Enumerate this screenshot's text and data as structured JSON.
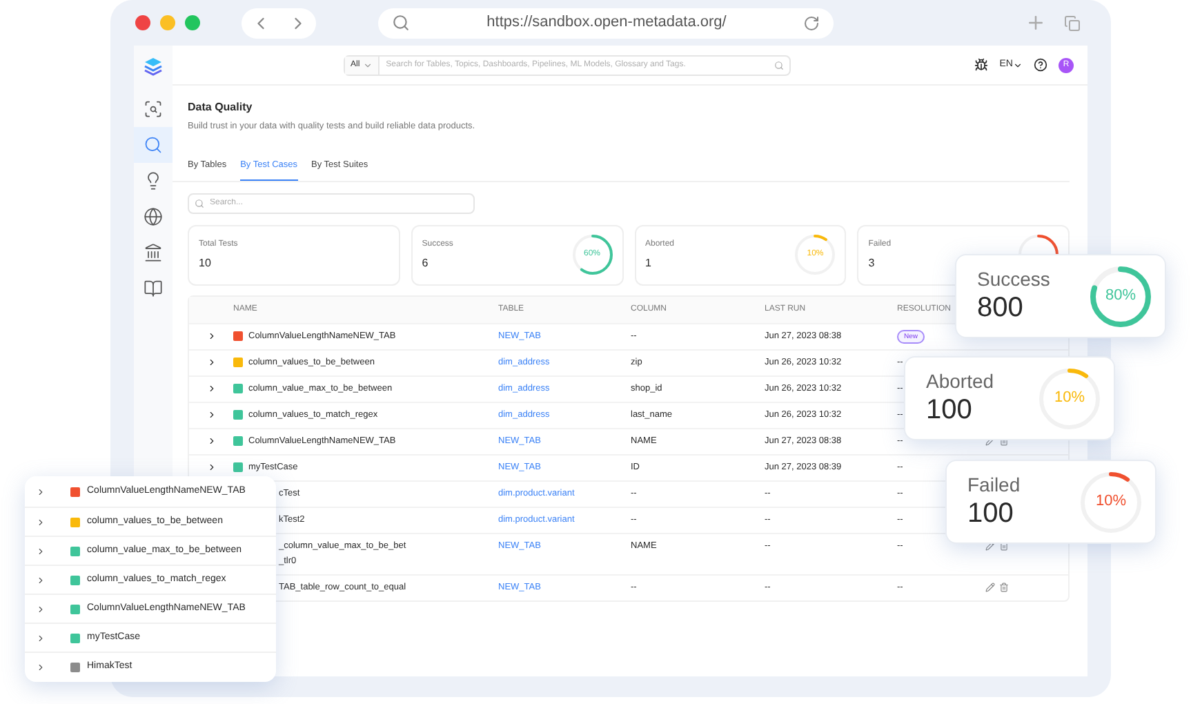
{
  "browser": {
    "url": "https://sandbox.open-metadata.org/"
  },
  "header": {
    "search_scope": "All",
    "search_placeholder": "Search for Tables, Topics, Dashboards, Pipelines, ML Models, Glossary and Tags.",
    "language": "EN",
    "avatar": "R"
  },
  "sidebar": {
    "items": [
      {
        "kind": "explore",
        "selected": false
      },
      {
        "kind": "quality",
        "selected": true
      },
      {
        "kind": "insights",
        "selected": false
      },
      {
        "kind": "domains",
        "selected": false
      },
      {
        "kind": "governance",
        "selected": false
      },
      {
        "kind": "glossary",
        "selected": false
      }
    ]
  },
  "page": {
    "title": "Data Quality",
    "subtitle": "Build trust in your data with quality tests and build reliable data products."
  },
  "tabs": [
    {
      "label": "By Tables",
      "selected": false
    },
    {
      "label": "By Test Cases",
      "selected": true
    },
    {
      "label": "By Test Suites",
      "selected": false
    }
  ],
  "search": {
    "placeholder": "Search..."
  },
  "stats": [
    {
      "kind": "total",
      "label": "Total Tests",
      "value": "10"
    },
    {
      "kind": "success",
      "label": "Success",
      "value": "6",
      "percent": "60%",
      "level": 0.6
    },
    {
      "kind": "aborted",
      "label": "Aborted",
      "value": "1",
      "percent": "10%",
      "level": 0.1
    },
    {
      "kind": "failed",
      "label": "Failed",
      "value": "3",
      "level": 0.3
    }
  ],
  "table": {
    "columns": [
      "NAME",
      "TABLE",
      "COLUMN",
      "LAST RUN",
      "RESOLUTION"
    ],
    "rows": [
      {
        "name": "ColumnValueLengthNameNEW_TAB",
        "color": "#f0502f",
        "table": "NEW_TAB",
        "column": "--",
        "last_run": "Jun 27, 2023 08:38",
        "resolution": {
          "kind": "badge",
          "text": "New"
        }
      },
      {
        "name": "column_values_to_be_between",
        "color": "#f9b90b",
        "table": "dim_address",
        "column": "zip",
        "last_run": "Jun 26, 2023 10:32",
        "resolution": "--"
      },
      {
        "name": "column_value_max_to_be_between",
        "color": "#3fc59a",
        "table": "dim_address",
        "column": "shop_id",
        "last_run": "Jun 26, 2023 10:32",
        "resolution": "--"
      },
      {
        "name": "column_values_to_match_regex",
        "color": "#3fc59a",
        "table": "dim_address",
        "column": "last_name",
        "last_run": "Jun 26, 2023 10:32",
        "resolution": "--"
      },
      {
        "name": "ColumnValueLengthNameNEW_TAB",
        "color": "#3fc59a",
        "table": "NEW_TAB",
        "column": "NAME",
        "last_run": "Jun 27, 2023 08:38",
        "resolution": "--",
        "actions": true
      },
      {
        "name": "myTestCase",
        "color": "#3fc59a",
        "table": "NEW_TAB",
        "column": "ID",
        "last_run": "Jun 27, 2023 08:39",
        "resolution": "--"
      },
      {
        "name": "cTest",
        "covered": true,
        "table": "dim.product.variant",
        "column": "--",
        "last_run": "--",
        "resolution": "--"
      },
      {
        "name": "kTest2",
        "covered": true,
        "table": "dim.product.variant",
        "column": "--",
        "last_run": "--",
        "resolution": "--"
      },
      {
        "name": "_column_value_max_to_be_bet",
        "name_continued": "_tlr0",
        "covered": true,
        "table": "NEW_TAB",
        "column": "NAME",
        "last_run": "--",
        "resolution": "--",
        "actions": true
      },
      {
        "name": "TAB_table_row_count_to_equal",
        "covered": true,
        "table": "NEW_TAB",
        "column": "--",
        "last_run": "--",
        "resolution": "--",
        "actions": true
      }
    ]
  },
  "floating_cards": [
    {
      "kind": "success",
      "label": "Success",
      "value": "800",
      "percent": "80%",
      "level": 0.8
    },
    {
      "kind": "aborted",
      "label": "Aborted",
      "value": "100",
      "percent": "10%",
      "level": 0.1
    },
    {
      "kind": "failed",
      "label": "Failed",
      "value": "100",
      "percent": "10%",
      "level": 0.1
    }
  ],
  "floating_list": [
    {
      "name": "ColumnValueLengthNameNEW_TAB",
      "color": "#f0502f"
    },
    {
      "name": "column_values_to_be_between",
      "color": "#f9b90b"
    },
    {
      "name": "column_value_max_to_be_between",
      "color": "#3fc59a"
    },
    {
      "name": "column_values_to_match_regex",
      "color": "#3fc59a"
    },
    {
      "name": "ColumnValueLengthNameNEW_TAB",
      "color": "#3fc59a"
    },
    {
      "name": "myTestCase",
      "color": "#3fc59a"
    },
    {
      "name": "HimakTest",
      "color": "#8c8c8c"
    }
  ]
}
